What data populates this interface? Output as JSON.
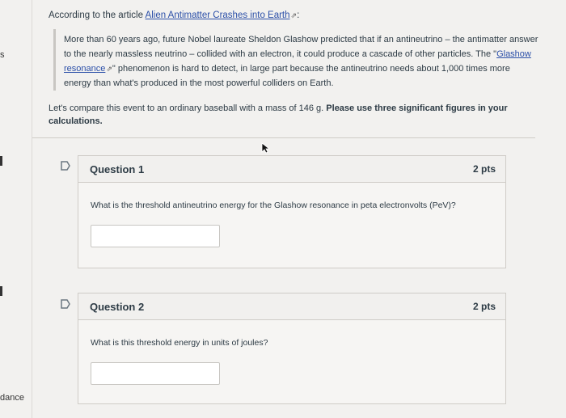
{
  "left_nav": {
    "fragment_top": "s",
    "fragment_bottom": "dance"
  },
  "intro": {
    "prefix": "According to the article ",
    "article_link": "Alien Antimatter Crashes into Earth",
    "suffix": ":"
  },
  "quote": {
    "part1": "More than 60 years ago, future Nobel laureate Sheldon Glashow predicted that if an antineutrino – the antimatter answer to the nearly massless neutrino – collided with an electron, it could produce a cascade of other particles. The \"",
    "link": "Glashow resonance",
    "part2": "\" phenomenon is hard to detect, in large part because the antineutrino needs about 1,000 times more energy than what's produced in the most powerful colliders on Earth."
  },
  "compare": {
    "text": "Let's compare this event to an ordinary baseball with a mass of 146 g. ",
    "bold": "Please use three significant figures in your calculations."
  },
  "questions": [
    {
      "title": "Question 1",
      "points": "2 pts",
      "text": "What is the threshold antineutrino energy for the Glashow resonance in peta electronvolts (PeV)?"
    },
    {
      "title": "Question 2",
      "points": "2 pts",
      "text": "What is this threshold energy in units of joules?"
    }
  ],
  "icons": {
    "external_link": "external-link-icon",
    "flag": "flag-icon",
    "cursor": "mouse-cursor-icon"
  }
}
